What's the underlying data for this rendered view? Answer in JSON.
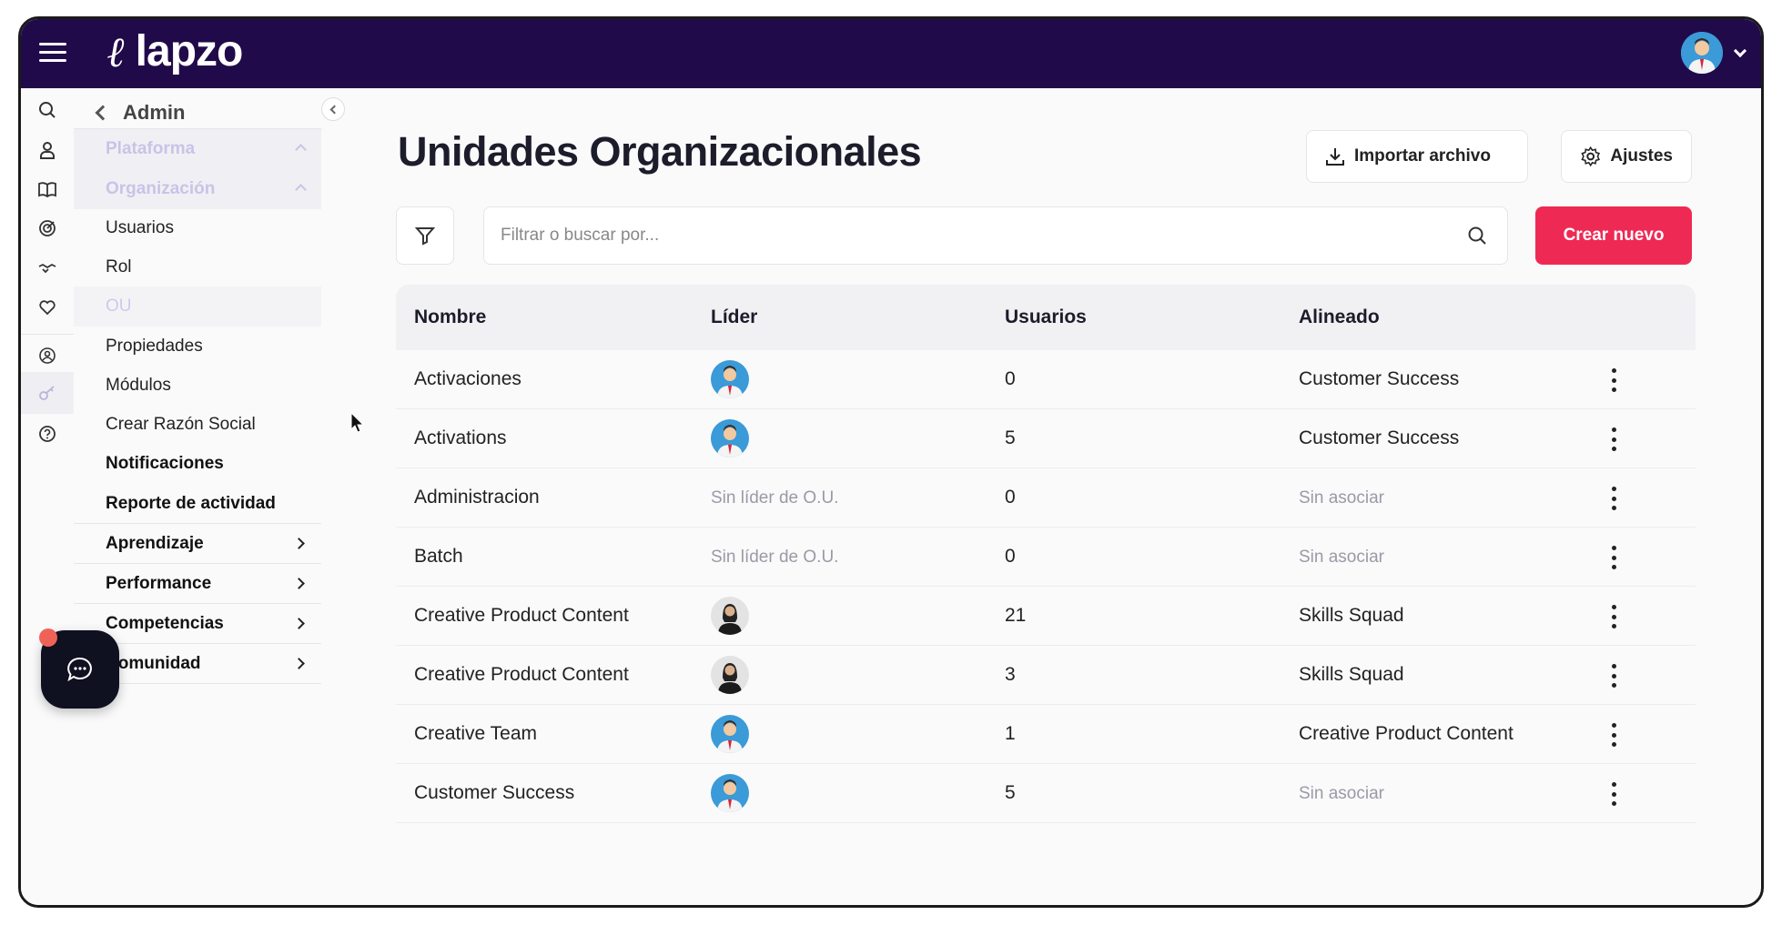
{
  "app": {
    "brand": "lapzo"
  },
  "submenu": {
    "back_label": "Admin",
    "items": [
      {
        "label": "Plataforma"
      },
      {
        "label": "Organización"
      },
      {
        "label": "Usuarios"
      },
      {
        "label": "Rol"
      },
      {
        "label": "OU"
      },
      {
        "label": "Propiedades"
      },
      {
        "label": "Módulos"
      },
      {
        "label": "Crear Razón Social"
      },
      {
        "label": "Notificaciones"
      },
      {
        "label": "Reporte de actividad"
      },
      {
        "label": "Aprendizaje"
      },
      {
        "label": "Performance"
      },
      {
        "label": "Competencias"
      },
      {
        "label": "Comunidad"
      }
    ]
  },
  "main": {
    "title": "Unidades Organizacionales",
    "import_label": "Importar archivo",
    "settings_label": "Ajustes",
    "search_placeholder": "Filtrar o buscar por...",
    "create_label": "Crear nuevo",
    "columns": [
      "Nombre",
      "Líder",
      "Usuarios",
      "Alineado"
    ],
    "rows": [
      {
        "name": "Activaciones",
        "leader": "avatar-man",
        "leader_text": "",
        "users": "0",
        "aligned": "Customer Success",
        "aligned_muted": false
      },
      {
        "name": "Activations",
        "leader": "avatar-man",
        "leader_text": "",
        "users": "5",
        "aligned": "Customer Success",
        "aligned_muted": false
      },
      {
        "name": "Administracion",
        "leader": "none",
        "leader_text": "Sin líder de O.U.",
        "users": "0",
        "aligned": "Sin asociar",
        "aligned_muted": true
      },
      {
        "name": "Batch",
        "leader": "none",
        "leader_text": "Sin líder de O.U.",
        "users": "0",
        "aligned": "Sin asociar",
        "aligned_muted": true
      },
      {
        "name": "Creative Product Content",
        "leader": "avatar-woman",
        "leader_text": "",
        "users": "21",
        "aligned": "Skills Squad",
        "aligned_muted": false
      },
      {
        "name": "Creative Product Content",
        "leader": "avatar-woman",
        "leader_text": "",
        "users": "3",
        "aligned": "Skills Squad",
        "aligned_muted": false
      },
      {
        "name": "Creative Team",
        "leader": "avatar-man",
        "leader_text": "",
        "users": "1",
        "aligned": "Creative Product Content",
        "aligned_muted": false
      },
      {
        "name": "Customer Success",
        "leader": "avatar-man",
        "leader_text": "",
        "users": "5",
        "aligned": "Sin asociar",
        "aligned_muted": true
      }
    ]
  },
  "colors": {
    "topbar": "#210a4a",
    "accent": "#ee2a54"
  }
}
